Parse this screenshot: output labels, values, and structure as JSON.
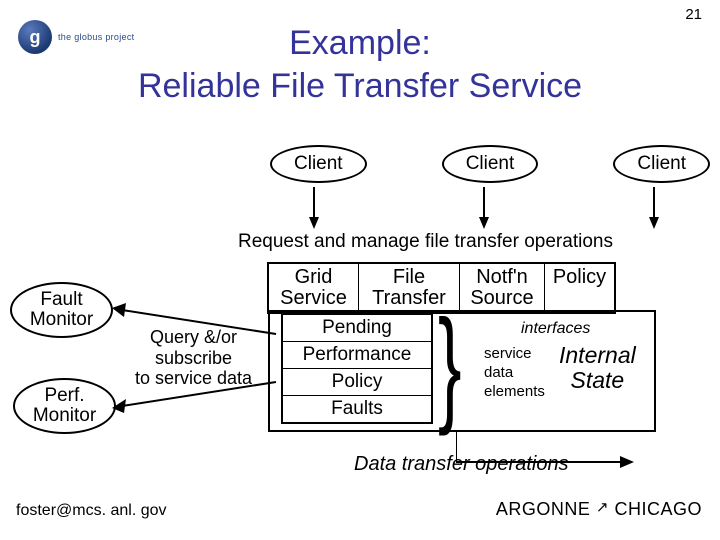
{
  "page_number": "21",
  "logo": {
    "glyph": "g",
    "text": "the globus project"
  },
  "title": "Example:\nReliable File Transfer Service",
  "clients": [
    "Client",
    "Client",
    "Client"
  ],
  "request_manage": "Request and manage file transfer operations",
  "interface_headers": [
    [
      "Grid",
      "Service"
    ],
    [
      "File",
      "Transfer"
    ],
    [
      "Notf'n",
      "Source"
    ],
    [
      "Policy",
      ""
    ]
  ],
  "interfaces_label": "interfaces",
  "data_elements": [
    "Pending",
    "Performance",
    "Policy",
    "Faults"
  ],
  "service_data_elements": "service\ndata\nelements",
  "internal_state": [
    "Internal",
    "State"
  ],
  "monitors": {
    "fault": [
      "Fault",
      "Monitor"
    ],
    "perf": [
      "Perf.",
      "Monitor"
    ]
  },
  "query_subscribe": "Query &/or\nsubscribe\nto service data",
  "data_transfer_ops": "Data transfer operations",
  "footer": {
    "email": "foster@mcs. anl. gov",
    "org_left": "ARGONNE",
    "org_right": "CHICAGO"
  }
}
